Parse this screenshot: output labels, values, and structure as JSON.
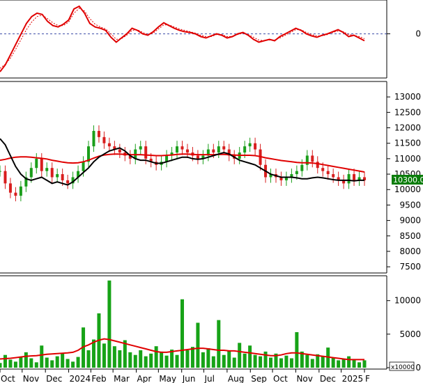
{
  "colors": {
    "price_up": "#1a9e1a",
    "price_down": "#d81e1e",
    "ma_long": "#e00000",
    "ma_short": "#000000",
    "osc_line": "#e00000",
    "volume_bar": "#17a317",
    "volume_ma": "#e00000",
    "last_price_bg": "#0a7d0a",
    "frame": "#000000",
    "zero_line": "#3b4aa8"
  },
  "x_axis": {
    "labels": [
      "Oct",
      "Nov",
      "Dec",
      "2024",
      "Feb",
      "Mar",
      "Apr",
      "May",
      "Jun",
      "Jul",
      "Aug",
      "Sep",
      "Oct",
      "Nov",
      "Dec",
      "2025",
      "F"
    ],
    "label_index": [
      0,
      20,
      41,
      62,
      82,
      102,
      123,
      143,
      164,
      184,
      205,
      226,
      246,
      267,
      288,
      308,
      329
    ]
  },
  "chart_data": [
    {
      "type": "line",
      "panel": "oscillator",
      "yticks": [
        0
      ],
      "ylim": [
        -60,
        45
      ],
      "zero_line": true,
      "series": [
        {
          "role": "oscillator",
          "style": "solid",
          "values": [
            -55,
            -45,
            -30,
            -15,
            0,
            15,
            25,
            30,
            28,
            18,
            12,
            10,
            14,
            20,
            36,
            40,
            30,
            15,
            10,
            8,
            5,
            -5,
            -12,
            -6,
            0,
            8,
            5,
            0,
            -2,
            3,
            10,
            16,
            12,
            8,
            5,
            3,
            2,
            0,
            -4,
            -6,
            -3,
            0,
            -2,
            -6,
            -4,
            0,
            2,
            -2,
            -8,
            -12,
            -10,
            -8,
            -10,
            -4,
            0,
            4,
            8,
            5,
            0,
            -3,
            -5,
            -2,
            0,
            3,
            6,
            2,
            -4,
            -2,
            -6,
            -10
          ]
        },
        {
          "role": "signal",
          "style": "dashed",
          "values": [
            -50,
            -44,
            -35,
            -22,
            -8,
            6,
            17,
            25,
            27,
            22,
            16,
            12,
            12,
            17,
            30,
            37,
            33,
            22,
            14,
            10,
            7,
            0,
            -8,
            -7,
            -2,
            5,
            6,
            2,
            -1,
            1,
            7,
            13,
            13,
            10,
            7,
            5,
            3,
            1,
            -2,
            -4,
            -4,
            -1,
            -1,
            -4,
            -4,
            -1,
            1,
            -1,
            -5,
            -9,
            -10,
            -9,
            -9,
            -6,
            -2,
            2,
            6,
            6,
            2,
            -1,
            -3,
            -3,
            -1,
            2,
            4,
            3,
            -1,
            -2,
            -4,
            -7
          ]
        }
      ]
    },
    {
      "type": "candlestick",
      "panel": "price",
      "yticks": [
        7500,
        8000,
        8500,
        9000,
        9500,
        10000,
        10500,
        11000,
        11500,
        12000,
        12500,
        13000
      ],
      "ylim": [
        7300,
        13500
      ],
      "last_price": "10300.00",
      "close": [
        10600,
        10200,
        9900,
        9800,
        10100,
        10400,
        10700,
        11000,
        10600,
        10700,
        10400,
        10500,
        10300,
        10200,
        10400,
        10600,
        10900,
        11400,
        11900,
        11700,
        11500,
        11400,
        11300,
        11200,
        11100,
        11000,
        11300,
        11400,
        11000,
        10900,
        10800,
        10900,
        11100,
        11200,
        11400,
        11300,
        11200,
        11100,
        11000,
        11100,
        11300,
        11200,
        11400,
        11300,
        11100,
        11000,
        11200,
        11400,
        11500,
        11300,
        10800,
        10400,
        10500,
        10400,
        10300,
        10400,
        10500,
        10600,
        10800,
        11100,
        10900,
        10700,
        10600,
        10500,
        10400,
        10300,
        10200,
        10500,
        10300,
        10400,
        10300
      ],
      "ma_long": [
        10950,
        10980,
        11020,
        11050,
        11060,
        11060,
        11050,
        11030,
        11010,
        10990,
        10950,
        10920,
        10890,
        10870,
        10860,
        10870,
        10900,
        10950,
        11020,
        11080,
        11120,
        11140,
        11150,
        11150,
        11140,
        11130,
        11130,
        11130,
        11120,
        11110,
        11100,
        11100,
        11110,
        11120,
        11140,
        11150,
        11150,
        11140,
        11130,
        11130,
        11130,
        11130,
        11140,
        11140,
        11130,
        11120,
        11110,
        11110,
        11110,
        11100,
        11070,
        11030,
        11000,
        10970,
        10940,
        10920,
        10900,
        10880,
        10870,
        10870,
        10860,
        10840,
        10810,
        10780,
        10750,
        10720,
        10690,
        10660,
        10630,
        10600,
        10570
      ],
      "ma_short": [
        11650,
        11450,
        11100,
        10750,
        10500,
        10350,
        10300,
        10350,
        10400,
        10300,
        10200,
        10250,
        10200,
        10150,
        10250,
        10400,
        10550,
        10700,
        10900,
        11050,
        11150,
        11250,
        11300,
        11350,
        11250,
        11100,
        11000,
        10950,
        10950,
        10900,
        10850,
        10850,
        10900,
        10950,
        11000,
        11050,
        11050,
        11000,
        10980,
        11000,
        11050,
        11100,
        11150,
        11200,
        11150,
        11050,
        10950,
        10900,
        10850,
        10800,
        10700,
        10600,
        10500,
        10450,
        10400,
        10400,
        10400,
        10380,
        10350,
        10350,
        10380,
        10400,
        10380,
        10350,
        10320,
        10300,
        10300,
        10300,
        10280,
        10300,
        10300
      ]
    },
    {
      "type": "bar",
      "panel": "volume",
      "yticks": [
        0,
        5000,
        10000
      ],
      "ylim": [
        0,
        13500
      ],
      "unit": "x10000",
      "values": [
        700,
        1900,
        1200,
        900,
        1600,
        2300,
        1400,
        800,
        3300,
        1500,
        1100,
        1700,
        2100,
        1300,
        900,
        1600,
        6000,
        2600,
        4200,
        8100,
        3600,
        13000,
        3200,
        2600,
        4100,
        2300,
        1900,
        2600,
        1700,
        2100,
        3200,
        2400,
        1800,
        2700,
        1900,
        10200,
        2600,
        3100,
        6700,
        2300,
        2900,
        1700,
        7100,
        1900,
        2600,
        1500,
        3700,
        2100,
        3300,
        1900,
        1700,
        2400,
        1500,
        2100,
        1400,
        1800,
        1400,
        5300,
        2400,
        1900,
        1300,
        2000,
        1700,
        3000,
        1500,
        1100,
        1300,
        1700,
        1200,
        800,
        1100
      ],
      "ma": [
        1300,
        1350,
        1400,
        1500,
        1600,
        1700,
        1750,
        1800,
        1900,
        2000,
        2050,
        2100,
        2150,
        2200,
        2300,
        2600,
        3100,
        3400,
        3800,
        4100,
        4300,
        4200,
        4000,
        3800,
        3600,
        3400,
        3200,
        3000,
        2800,
        2600,
        2400,
        2300,
        2300,
        2400,
        2500,
        2600,
        2700,
        2800,
        2900,
        2900,
        2800,
        2700,
        2600,
        2600,
        2500,
        2500,
        2400,
        2300,
        2200,
        2100,
        2000,
        1900,
        1800,
        1800,
        1900,
        2100,
        2200,
        2200,
        2100,
        2000,
        1900,
        1800,
        1700,
        1600,
        1500,
        1400,
        1300,
        1200,
        1200,
        1200,
        1200
      ]
    }
  ]
}
